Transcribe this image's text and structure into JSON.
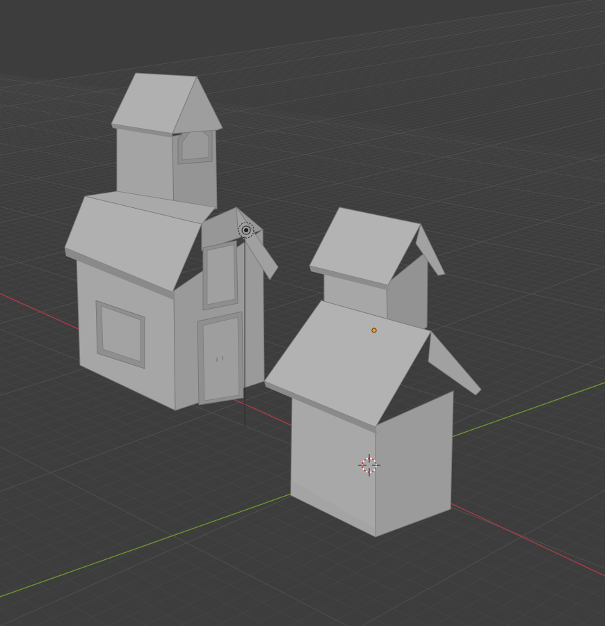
{
  "viewport": {
    "background": "#3d3d3d",
    "grid_minor_color": "#474747",
    "grid_major_color": "#4f4f4f",
    "axis_x_color": "#b43a44",
    "axis_y_color": "#6e9a2c",
    "mesh_light": "#a8a8a8",
    "mesh_mid": "#9a9a9a",
    "mesh_dark": "#858585",
    "mesh_edge": "#6f6f6f",
    "origin_color": "#f29422"
  },
  "scene": {
    "objects": [
      "house-large",
      "house-small"
    ],
    "icons": [
      "light-icon",
      "origin-dot-icon",
      "3d-cursor-icon"
    ]
  }
}
